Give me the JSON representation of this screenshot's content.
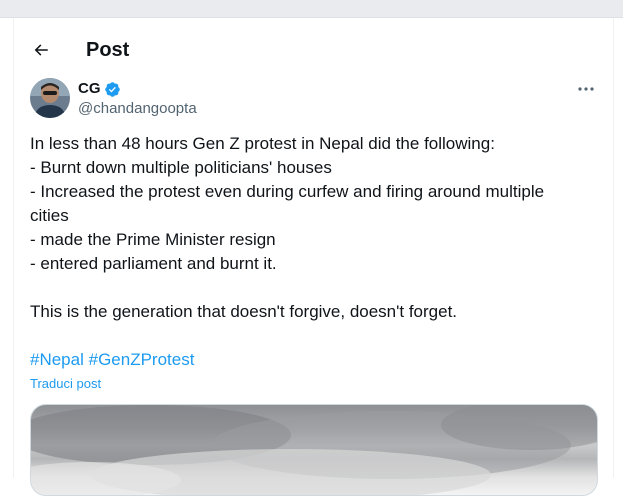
{
  "header": {
    "title": "Post",
    "back_icon": "arrow-left-icon"
  },
  "author": {
    "display_name": "CG",
    "handle": "@chandangoopta",
    "verified": true,
    "verified_color": "#1d9bf0"
  },
  "more_icon": "ellipsis-icon",
  "tweet": {
    "lines": [
      "In less than 48 hours Gen Z protest in Nepal did the following:",
      "- Burnt down multiple politicians' houses",
      "- Increased the protest even during curfew and firing around multiple",
      "cities",
      "- made the Prime Minister resign",
      "- entered parliament and burnt it.",
      "",
      "This is the generation that doesn't forgive, doesn't forget."
    ],
    "hashtags": [
      "#Nepal",
      "#GenZProtest"
    ],
    "translate_label": "Traduci post"
  },
  "colors": {
    "link": "#1d9bf0",
    "text": "#0f1419",
    "secondary": "#536471"
  }
}
